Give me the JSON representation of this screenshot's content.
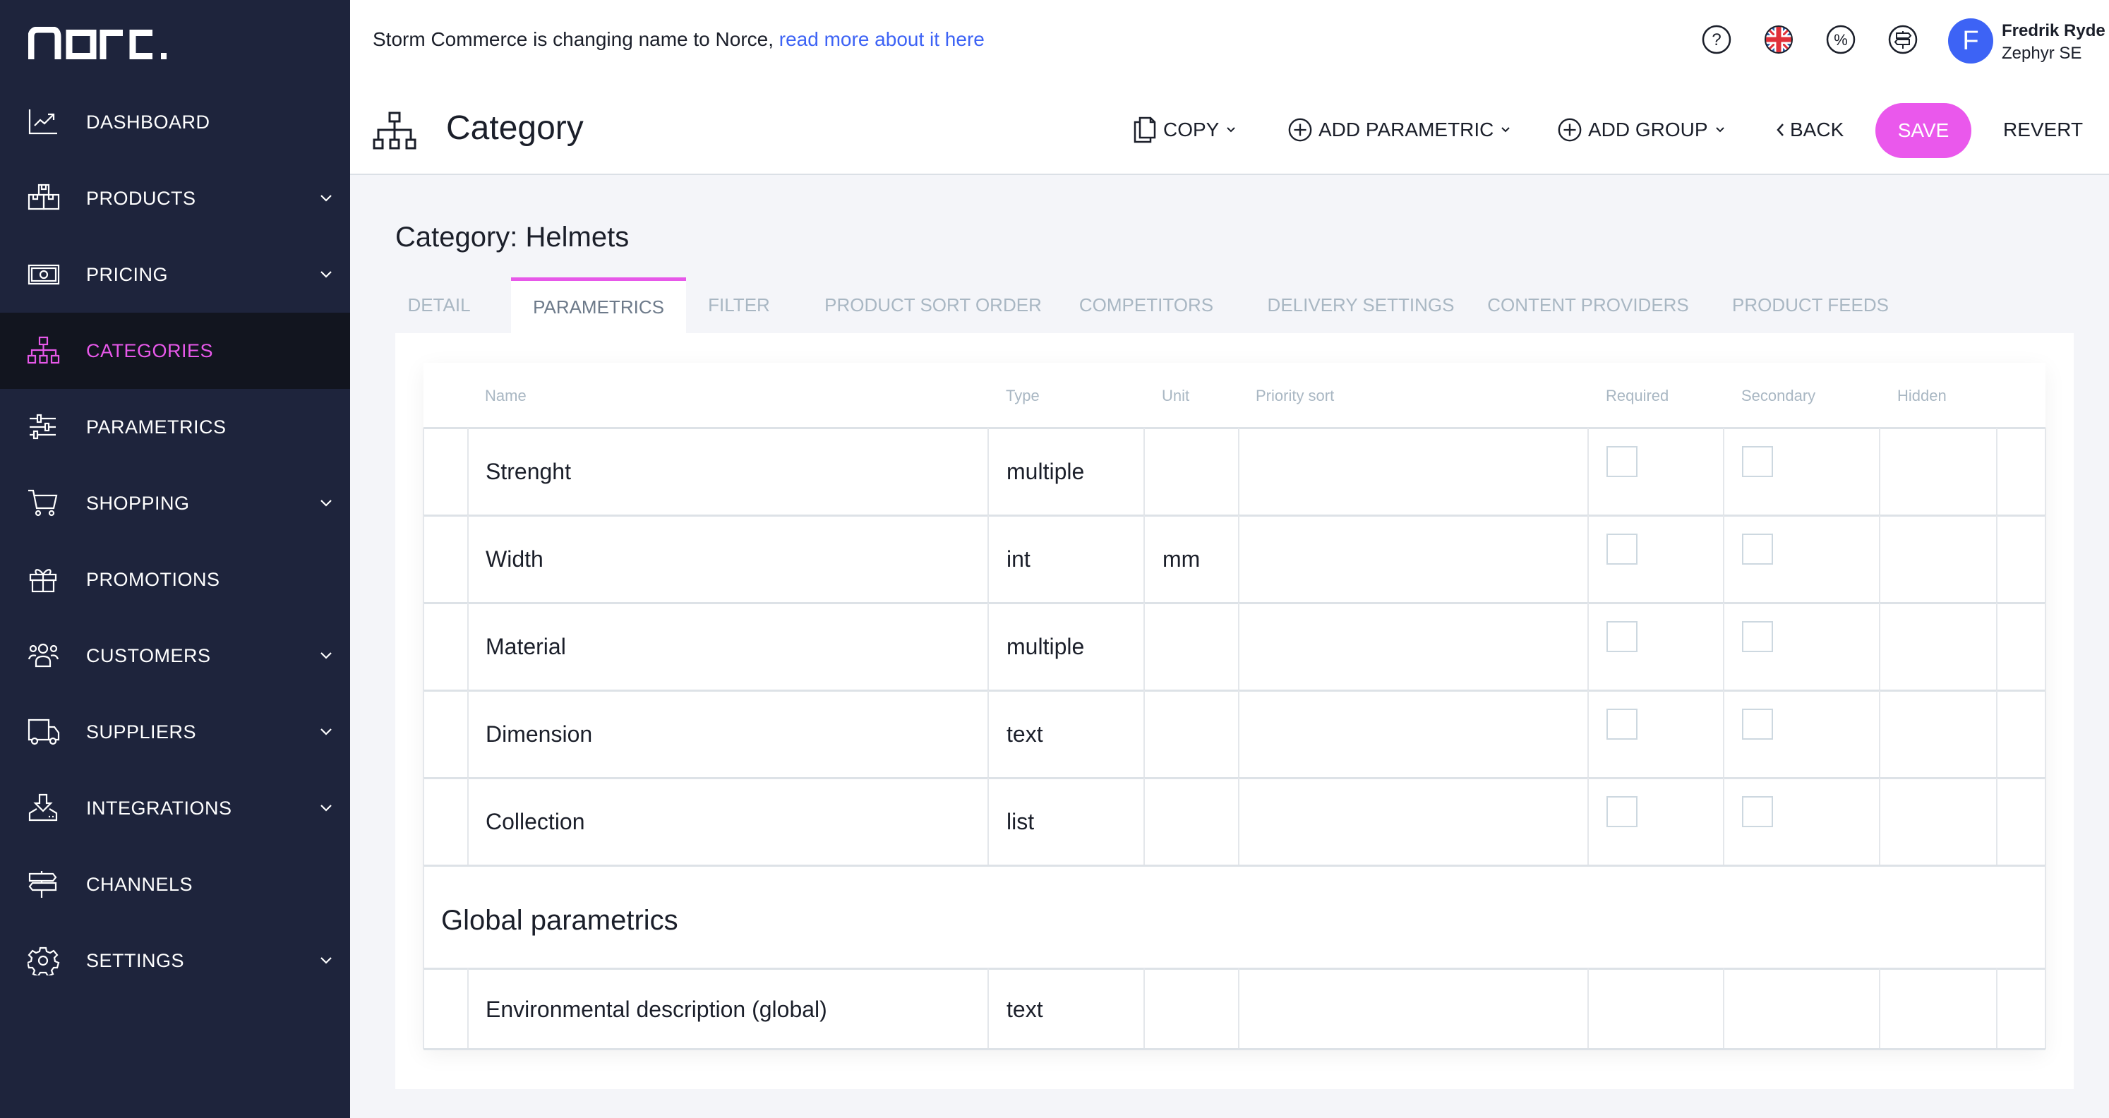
{
  "brand": {
    "logo_text": "norce",
    "accent": "#e758e9",
    "sidebar_bg": "#1e243c",
    "link": "#3d63f5"
  },
  "sidebar": {
    "items": [
      {
        "label": "DASHBOARD",
        "icon": "chart-line-icon",
        "has_chevron": false,
        "active": false
      },
      {
        "label": "PRODUCTS",
        "icon": "boxes-icon",
        "has_chevron": true,
        "active": false
      },
      {
        "label": "PRICING",
        "icon": "banknote-icon",
        "has_chevron": true,
        "active": false
      },
      {
        "label": "CATEGORIES",
        "icon": "sitemap-icon",
        "has_chevron": false,
        "active": true
      },
      {
        "label": "PARAMETRICS",
        "icon": "sliders-icon",
        "has_chevron": false,
        "active": false
      },
      {
        "label": "SHOPPING",
        "icon": "cart-icon",
        "has_chevron": true,
        "active": false
      },
      {
        "label": "PROMOTIONS",
        "icon": "gift-icon",
        "has_chevron": false,
        "active": false
      },
      {
        "label": "CUSTOMERS",
        "icon": "users-icon",
        "has_chevron": true,
        "active": false
      },
      {
        "label": "SUPPLIERS",
        "icon": "truck-icon",
        "has_chevron": true,
        "active": false
      },
      {
        "label": "INTEGRATIONS",
        "icon": "download-tray-icon",
        "has_chevron": true,
        "active": false
      },
      {
        "label": "CHANNELS",
        "icon": "signpost-icon",
        "has_chevron": false,
        "active": false
      },
      {
        "label": "SETTINGS",
        "icon": "gear-icon",
        "has_chevron": true,
        "active": false
      }
    ]
  },
  "notice": {
    "text": "Storm Commerce is changing name to Norce, ",
    "link_text": "read more about it here"
  },
  "topbar_icons": [
    "help-icon",
    "uk-flag-icon",
    "percent-icon",
    "signpost-icon"
  ],
  "user": {
    "initial": "F",
    "name": "Fredrik Ryde",
    "org": "Zephyr SE"
  },
  "header": {
    "title": "Category",
    "toolbar": {
      "copy": "COPY",
      "add_parametric": "ADD PARAMETRIC",
      "add_group": "ADD GROUP",
      "back": "BACK",
      "save": "SAVE",
      "revert": "REVERT"
    }
  },
  "content": {
    "title": "Category: Helmets",
    "tabs": [
      {
        "label": "DETAIL",
        "active": false
      },
      {
        "label": "PARAMETRICS",
        "active": true
      },
      {
        "label": "FILTER",
        "active": false
      },
      {
        "label": "PRODUCT SORT ORDER",
        "active": false
      },
      {
        "label": "COMPETITORS",
        "active": false
      },
      {
        "label": "DELIVERY SETTINGS",
        "active": false
      },
      {
        "label": "CONTENT PROVIDERS",
        "active": false
      },
      {
        "label": "PRODUCT FEEDS",
        "active": false
      }
    ]
  },
  "table": {
    "headers": {
      "name": "Name",
      "type": "Type",
      "unit": "Unit",
      "priority": "Priority sort",
      "required": "Required",
      "secondary": "Secondary",
      "hidden": "Hidden"
    },
    "rows": [
      {
        "name": "Strenght",
        "type": "multiple",
        "unit": "",
        "required": false,
        "secondary": false
      },
      {
        "name": "Width",
        "type": "int",
        "unit": "mm",
        "required": false,
        "secondary": false
      },
      {
        "name": "Material",
        "type": "multiple",
        "unit": "",
        "required": false,
        "secondary": false
      },
      {
        "name": "Dimension",
        "type": "text",
        "unit": "",
        "required": false,
        "secondary": false
      },
      {
        "name": "Collection",
        "type": "list",
        "unit": "",
        "required": false,
        "secondary": false
      }
    ],
    "global_group_title": "Global parametrics",
    "global_rows": [
      {
        "name": "Environmental description (global)",
        "type": "text",
        "unit": ""
      }
    ]
  }
}
